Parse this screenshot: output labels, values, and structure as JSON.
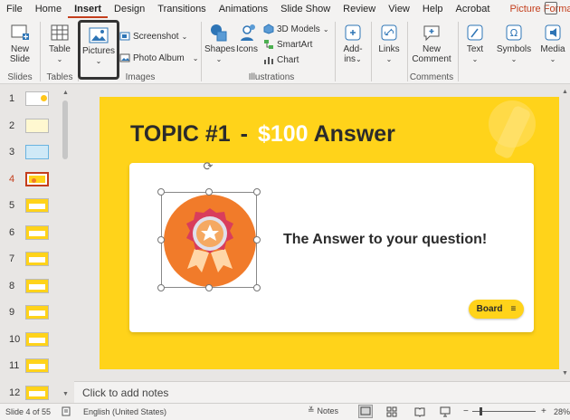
{
  "tabs": [
    "File",
    "Home",
    "Insert",
    "Design",
    "Transitions",
    "Animations",
    "Slide Show",
    "Review",
    "View",
    "Help",
    "Acrobat",
    "Picture Format"
  ],
  "active_tab": "Insert",
  "ribbon": {
    "new_slide": "New\nSlide",
    "table": "Table",
    "pictures": "Pictures",
    "screenshot": "Screenshot",
    "photo_album": "Photo Album",
    "shapes": "Shapes",
    "icons": "Icons",
    "models_3d": "3D Models",
    "smartart": "SmartArt",
    "chart": "Chart",
    "addins": "Add-\nins",
    "links": "Links",
    "new_comment": "New\nComment",
    "text": "Text",
    "symbols": "Symbols",
    "media": "Media",
    "groups": {
      "slides": "Slides",
      "tables": "Tables",
      "images": "Images",
      "illustrations": "Illustrations",
      "comments": "Comments"
    }
  },
  "thumbnails": [
    "1",
    "2",
    "3",
    "4",
    "5",
    "6",
    "7",
    "8",
    "9",
    "10",
    "11",
    "12"
  ],
  "current_slide_index": 4,
  "slide": {
    "title_topic": "TOPIC #1",
    "title_dash": "-",
    "title_amount": "$100",
    "title_answer": "Answer",
    "answer_text": "The Answer to your question!",
    "board_button": "Board",
    "board_icon": "≡"
  },
  "notes_placeholder": "Click to add notes",
  "status": {
    "slide_counter": "Slide 4 of 55",
    "language": "English (United States)",
    "notes": "Notes",
    "zoom": "28%"
  },
  "colors": {
    "accent": "#c43e1c",
    "slide_yellow": "#ffd31a",
    "medal_orange": "#f17b2a",
    "text_dark": "#2b2b2b"
  }
}
